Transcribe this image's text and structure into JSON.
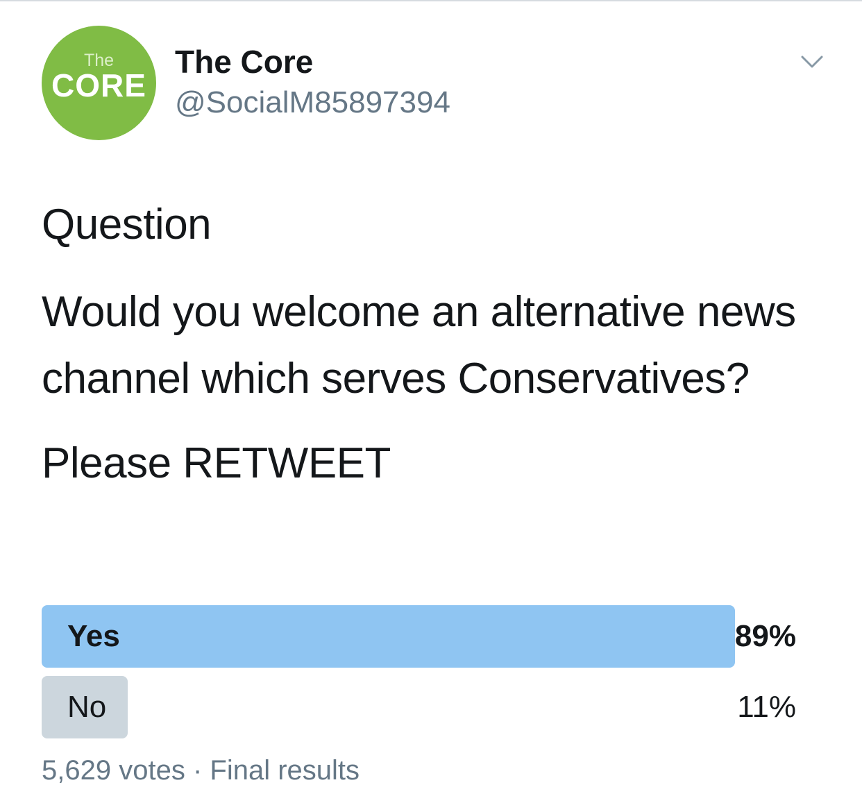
{
  "author": {
    "avatar_logo_small": "The",
    "avatar_logo_big": "CORE",
    "avatar_color": "#80bc45",
    "display_name": "The Core",
    "handle": "@SocialM85897394"
  },
  "menu_icon": "chevron-down-icon",
  "tweet": {
    "paragraphs": [
      "Question",
      "Would you welcome an alternative news channel which serves Conservatives?",
      "Please RETWEET"
    ]
  },
  "poll": {
    "options": [
      {
        "label": "Yes",
        "percent_text": "89%",
        "percent": 89,
        "winner": true,
        "bar_color": "#8fc5f2"
      },
      {
        "label": "No",
        "percent_text": "11%",
        "percent": 11,
        "winner": false,
        "bar_color": "#ccd6dd"
      }
    ],
    "votes": "5,629 votes",
    "separator": "·",
    "status": "Final results"
  }
}
